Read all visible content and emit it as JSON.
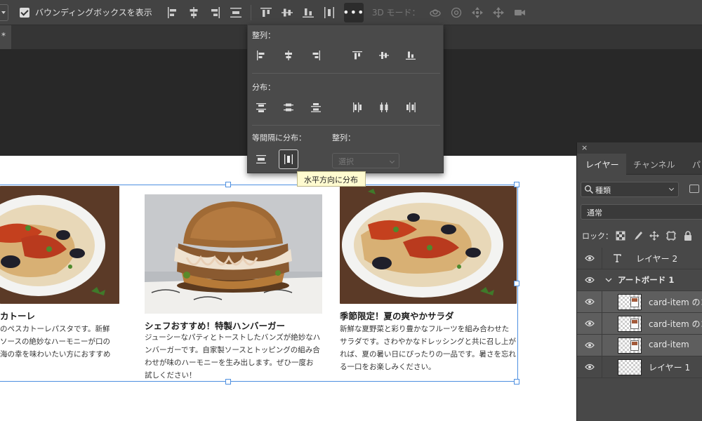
{
  "options_bar": {
    "bounding_box_label": "バウンディングボックスを表示",
    "bounding_box_checked": true,
    "more_label": "•••",
    "mode_3d_label": "3D モード："
  },
  "doc_tab": {
    "label": "*"
  },
  "align_popup": {
    "align_heading": "整列：",
    "distribute_heading": "分布：",
    "equal_spacing_heading": "等間隔に分布：",
    "align_to_heading": "整列：",
    "align_to_select_placeholder": "選択",
    "tooltip": "水平方向に分布"
  },
  "cards": [
    {
      "title": "カトーレ",
      "text": "のペスカトーレパスタです。新鮮\nソースの絶妙なハーモニーが口の\n海の幸を味わいたい方におすすめ"
    },
    {
      "title": "シェフおすすめ！特製ハンバーガー",
      "text": "ジューシーなパティとトーストしたバンズが絶妙なハ\nンバーガーです。自家製ソースとトッピングの組み合\nわせが味のハーモニーを生み出します。ぜひ一度お\n試しください！"
    },
    {
      "title": "季節限定！夏の爽やかサラダ",
      "text": "新鮮な夏野菜と彩り豊かなフルーツを組み合わせた\nサラダです。さわやかなドレッシングと共に召し上が\nれば、夏の暑い日にぴったりの一品です。暑さを忘れ\nる一口をお楽しみください。"
    }
  ],
  "layers_panel": {
    "close_label": "×",
    "tabs": [
      "レイヤー",
      "チャンネル",
      "パ"
    ],
    "filter_label": "種類",
    "blend_mode": "通常",
    "lock_label": "ロック：",
    "layers": [
      {
        "name": "レイヤー 2",
        "kind": "text",
        "indent": 1,
        "selected": false
      },
      {
        "name": "アートボード 1",
        "kind": "artboard",
        "indent": 0,
        "selected": false
      },
      {
        "name": "card-item のコ",
        "kind": "smart",
        "indent": 2,
        "selected": true
      },
      {
        "name": "card-item のコ",
        "kind": "smart",
        "indent": 2,
        "selected": true
      },
      {
        "name": "card-item",
        "kind": "smart",
        "indent": 2,
        "selected": true
      },
      {
        "name": "レイヤー 1",
        "kind": "pixel",
        "indent": 2,
        "selected": false
      }
    ]
  },
  "colors": {
    "selection": "#4d8fe0",
    "panel_bg": "#484848",
    "toolbar_bg": "#434343",
    "tooltip_bg": "#fffbd0"
  }
}
